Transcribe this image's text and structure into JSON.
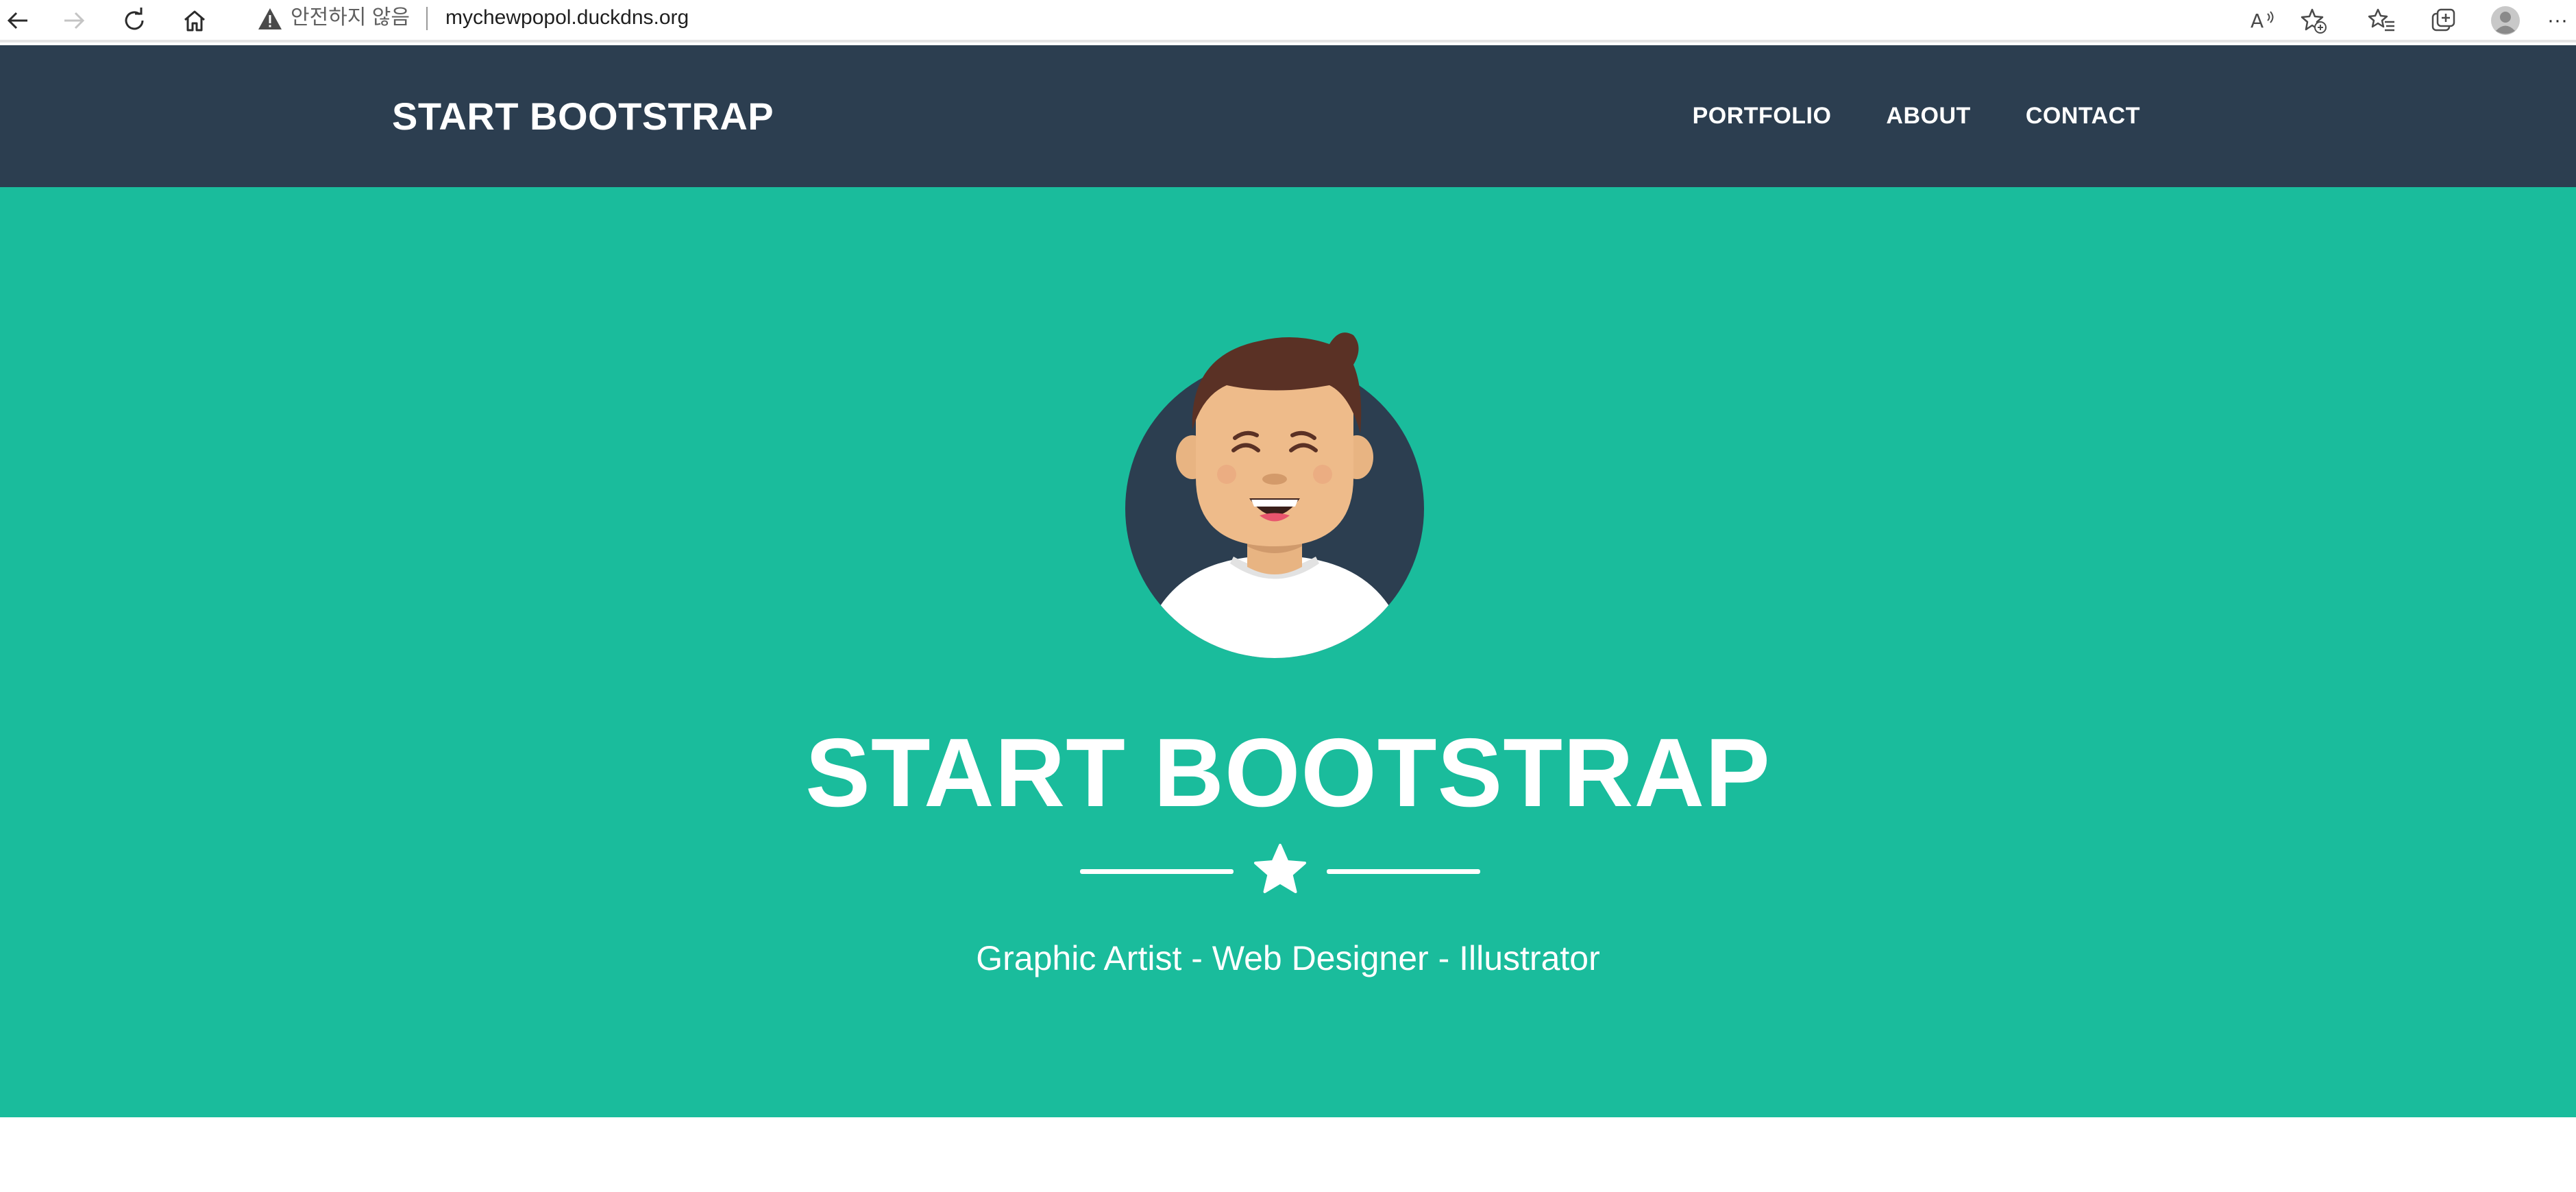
{
  "browser": {
    "security_label": "안전하지 않음",
    "url": "mychewpopol.duckdns.org",
    "icons": [
      "back-icon",
      "forward-icon",
      "refresh-icon",
      "home-icon",
      "warning-icon",
      "read-aloud-icon",
      "add-favorite-icon",
      "favorites-icon",
      "collections-icon",
      "profile-icon",
      "more-icon"
    ],
    "more_label": "···"
  },
  "navbar": {
    "brand": "START BOOTSTRAP",
    "links": [
      "PORTFOLIO",
      "ABOUT",
      "CONTACT"
    ],
    "background_color": "#2c3e50"
  },
  "hero": {
    "title": "START BOOTSTRAP",
    "subtitle": "Graphic Artist - Web Designer - Illustrator",
    "background_color": "#1abc9c",
    "divider_icon": "star-icon",
    "avatar": "avatar-illustration"
  }
}
